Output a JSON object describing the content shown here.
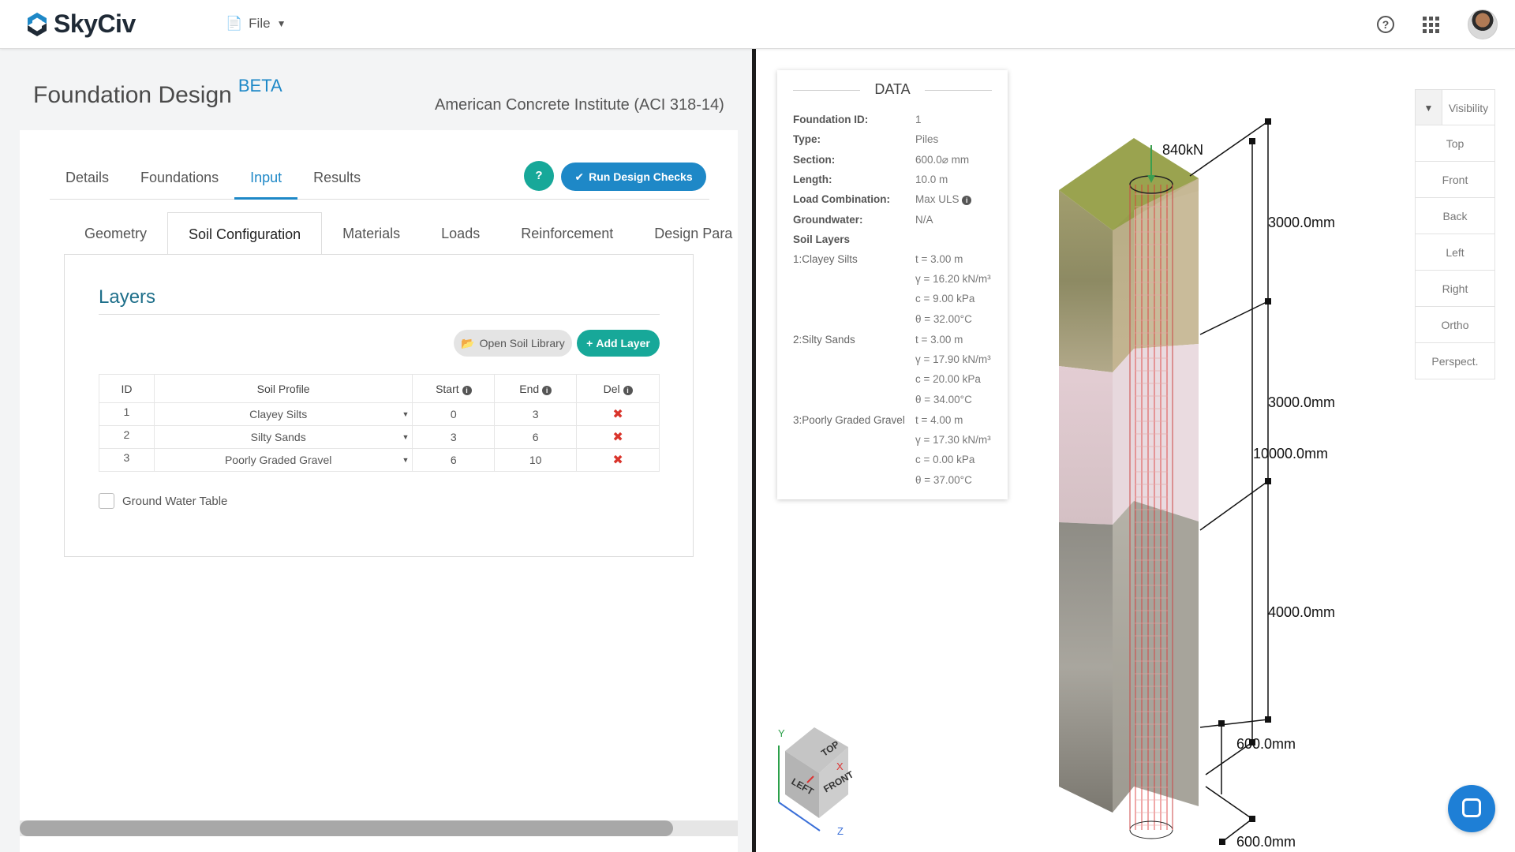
{
  "header": {
    "brand": "SkyCiv",
    "file_menu": "File"
  },
  "page": {
    "title": "Foundation Design",
    "badge": "BETA",
    "standard": "American Concrete Institute (ACI 318-14)"
  },
  "tabs": [
    "Details",
    "Foundations",
    "Input",
    "Results"
  ],
  "actions": {
    "help": "?",
    "run_checks": "Run Design Checks"
  },
  "subtabs": [
    "Geometry",
    "Soil Configuration",
    "Materials",
    "Loads",
    "Reinforcement",
    "Design Para"
  ],
  "layers": {
    "title": "Layers",
    "open_library": "Open Soil Library",
    "add_layer": "Add Layer",
    "columns": [
      "ID",
      "Soil Profile",
      "Start",
      "End",
      "Del"
    ],
    "rows": [
      {
        "id": "1",
        "profile": "Clayey Silts",
        "start": "0",
        "end": "3"
      },
      {
        "id": "2",
        "profile": "Silty Sands",
        "start": "3",
        "end": "6"
      },
      {
        "id": "3",
        "profile": "Poorly Graded Gravel",
        "start": "6",
        "end": "10"
      }
    ],
    "groundwater_label": "Ground Water Table"
  },
  "data_panel": {
    "title": "DATA",
    "fields": [
      {
        "k": "Foundation ID:",
        "v": "1"
      },
      {
        "k": "Type:",
        "v": "Piles"
      },
      {
        "k": "Section:",
        "v": "600.0⌀ mm"
      },
      {
        "k": "Length:",
        "v": "10.0 m"
      },
      {
        "k": "Load Combination:",
        "v": "Max ULS"
      },
      {
        "k": "Groundwater:",
        "v": "N/A"
      },
      {
        "k": "Soil Layers",
        "v": ""
      }
    ],
    "soil_layers": [
      {
        "name": "1:Clayey Silts",
        "t": "t = 3.00 m",
        "gamma": "γ = 16.20 kN/m³",
        "c": "c = 9.00 kPa",
        "theta": "θ = 32.00°C"
      },
      {
        "name": "2:Silty Sands",
        "t": "t = 3.00 m",
        "gamma": "γ = 17.90 kN/m³",
        "c": "c = 20.00 kPa",
        "theta": "θ = 34.00°C"
      },
      {
        "name": "3:Poorly Graded Gravel",
        "t": "t = 4.00 m",
        "gamma": "γ = 17.30 kN/m³",
        "c": "c = 0.00 kPa",
        "theta": "θ = 37.00°C"
      }
    ]
  },
  "view_buttons": {
    "visibility": "Visibility",
    "views": [
      "Top",
      "Front",
      "Back",
      "Left",
      "Right",
      "Ortho",
      "Perspect."
    ]
  },
  "model_labels": {
    "load": "840kN",
    "dim1": "3000.0mm",
    "dim2": "3000.0mm",
    "dim_total": "10000.0mm",
    "dim3": "4000.0mm",
    "width1": "600.0mm",
    "width2": "600.0mm"
  },
  "view_cube": {
    "top": "TOP",
    "left": "LEFT",
    "front": "FRONT",
    "axis_y": "Y",
    "axis_x": "X",
    "axis_z": "Z"
  },
  "colors": {
    "brand_blue": "#1e88c7",
    "teal": "#17a899",
    "delete_red": "#d9342b"
  }
}
